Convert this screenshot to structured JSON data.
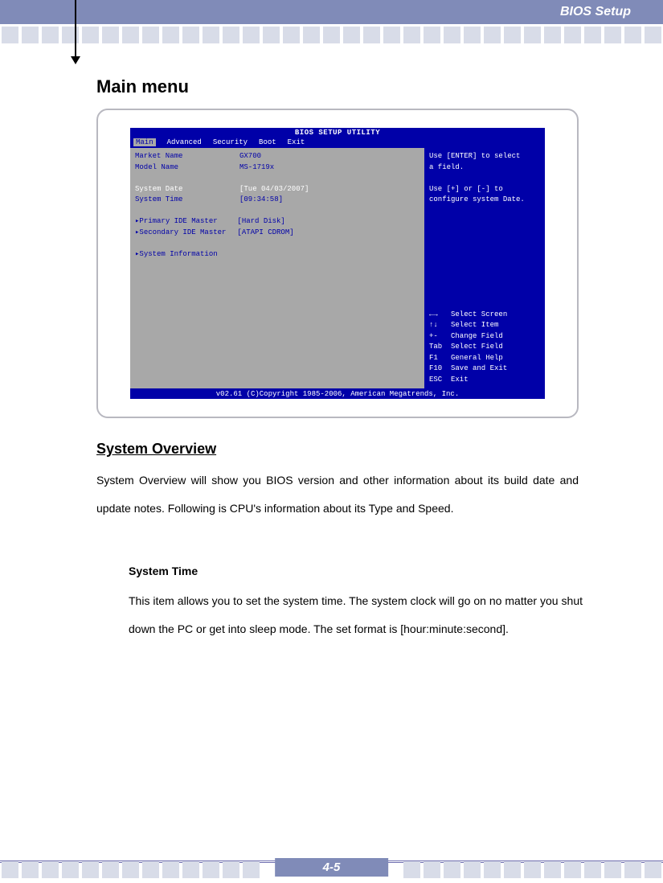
{
  "header": {
    "title": "BIOS Setup"
  },
  "main_title": "Main menu",
  "bios": {
    "title": "BIOS SETUP UTILITY",
    "tabs": [
      "Main",
      "Advanced",
      "Security",
      "Boot",
      "Exit"
    ],
    "left": {
      "market_name_lbl": "Market Name",
      "market_name_val": "GX700",
      "model_name_lbl": "Model Name",
      "model_name_val": "MS-1719x",
      "sysdate_lbl": "System Date",
      "sysdate_val": "[Tue 04/03/2007]",
      "systime_lbl": "System Time",
      "systime_val": "[09:34:58]",
      "pri_lbl": "Primary IDE Master",
      "pri_val": "[Hard Disk]",
      "sec_lbl": "Secondary IDE Master",
      "sec_val": "[ATAPI CDROM]",
      "sysinfo_lbl": "System Information"
    },
    "right": {
      "help1": "Use [ENTER] to select",
      "help2": "a field.",
      "help3": "Use [+] or [-] to",
      "help4": "configure system Date.",
      "k1": "←→   Select Screen",
      "k2": "↑↓   Select Item",
      "k3": "+-   Change Field",
      "k4": "Tab  Select Field",
      "k5": "F1   General Help",
      "k6": "F10  Save and Exit",
      "k7": "ESC  Exit"
    },
    "footer": "v02.61 (C)Copyright 1985-2006, American Megatrends, Inc."
  },
  "section": {
    "title": "System Overview",
    "p1": "System Overview will show you BIOS version and other information about its build date and update notes. Following is CPU's information about its Type and Speed.",
    "sub": "System Time",
    "p2": "This item allows you to set the system time.   The system clock will go on no matter you shut down the PC or get into sleep mode.   The set format is [hour:minute:second]."
  },
  "page_number": "4-5"
}
